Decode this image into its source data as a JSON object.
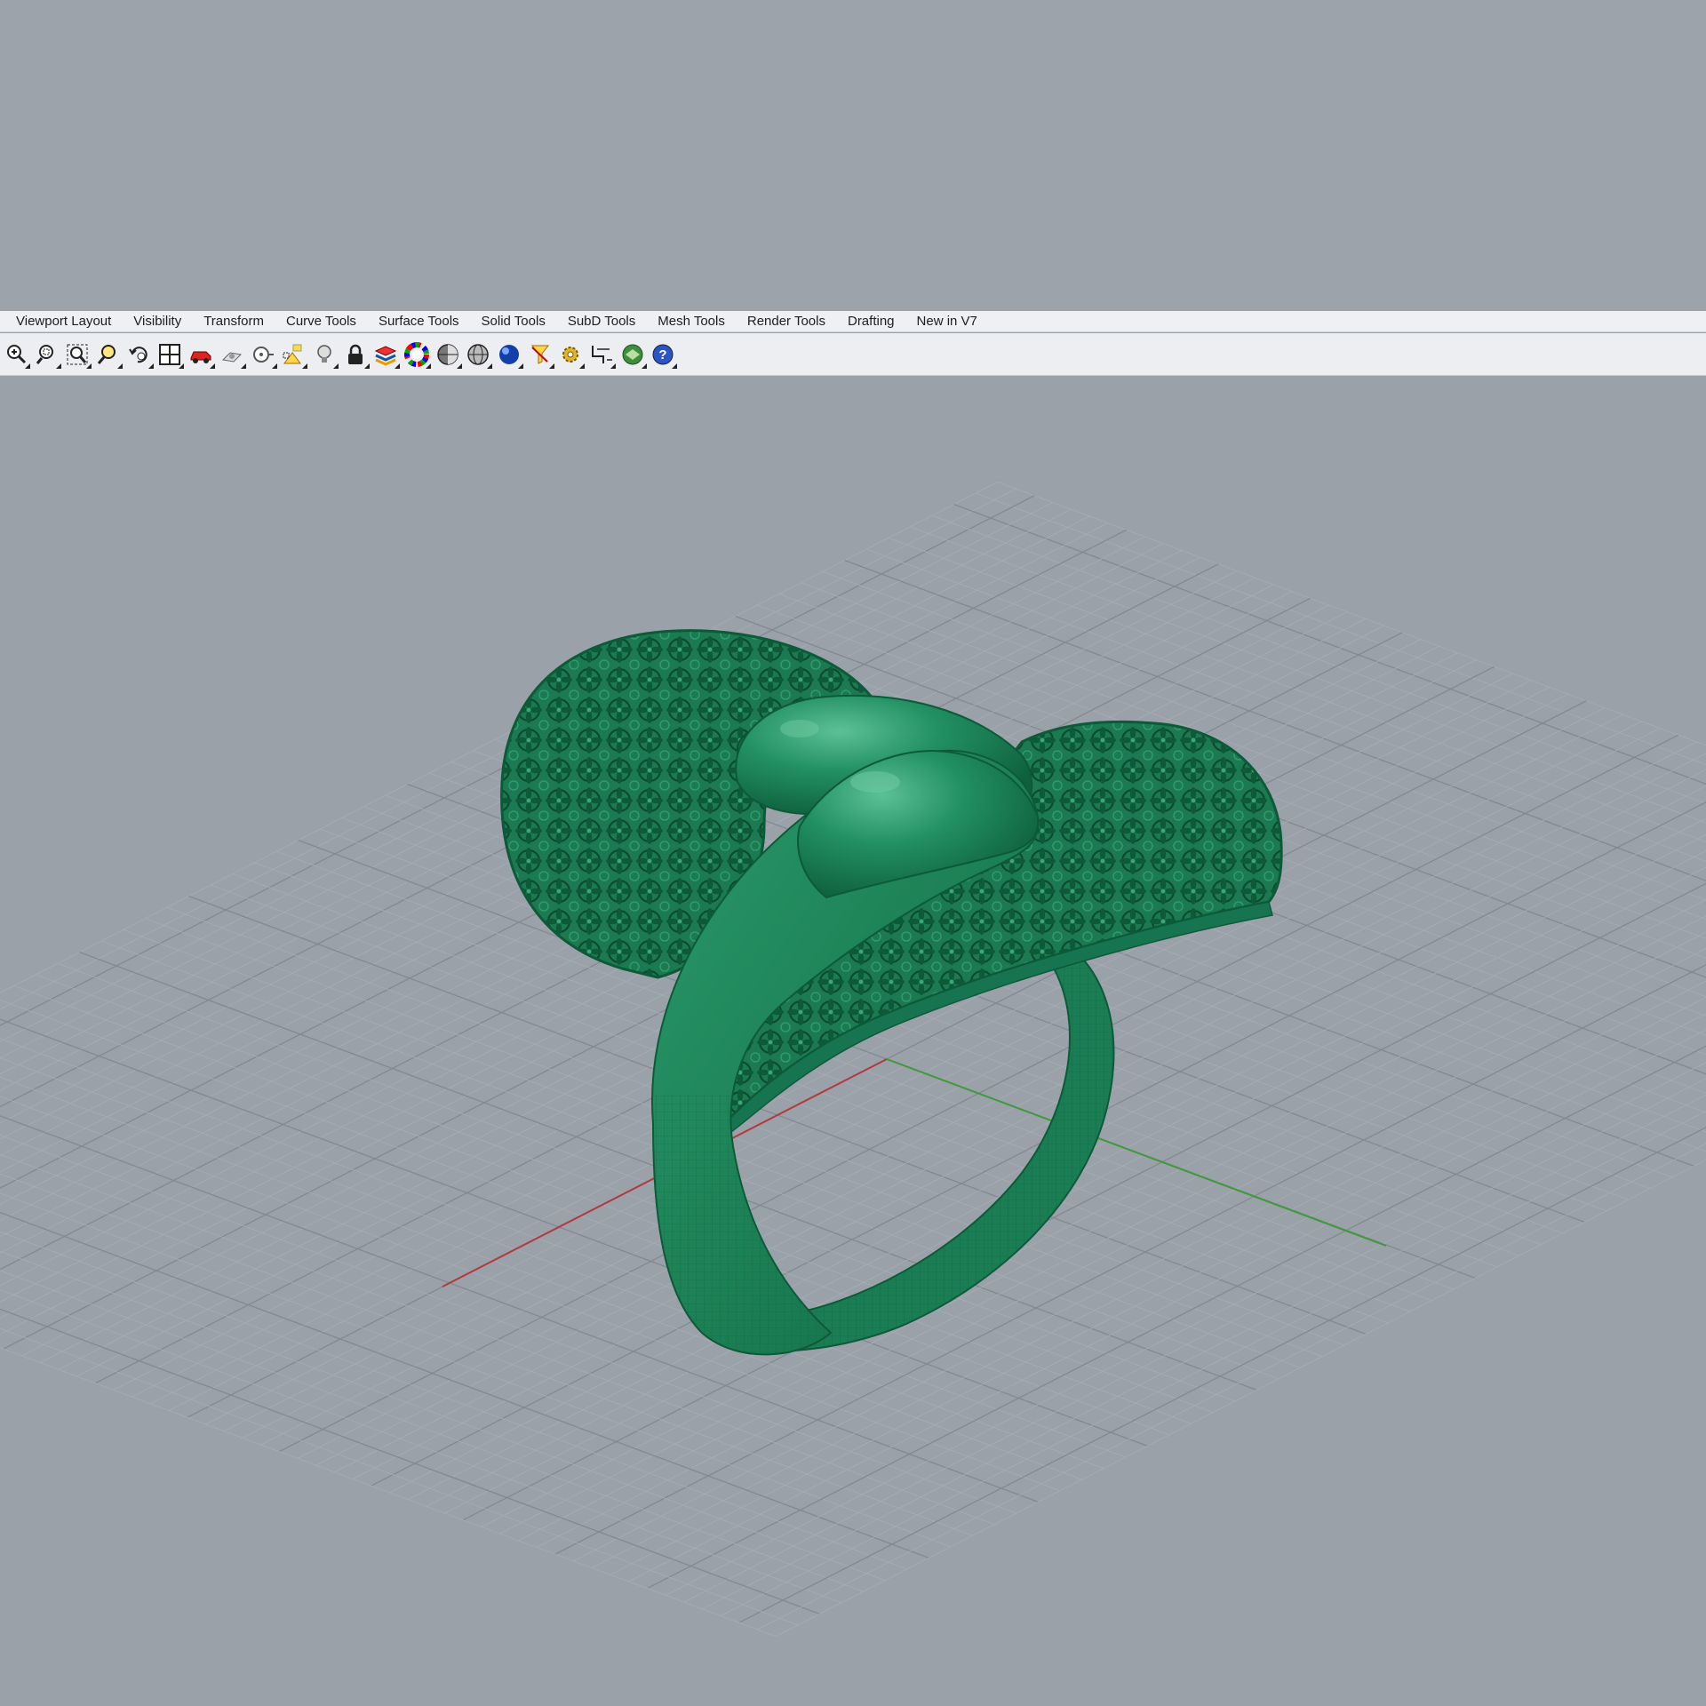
{
  "tabs": [
    {
      "label": "Viewport Layout"
    },
    {
      "label": "Visibility"
    },
    {
      "label": "Transform"
    },
    {
      "label": "Curve Tools"
    },
    {
      "label": "Surface Tools"
    },
    {
      "label": "Solid Tools"
    },
    {
      "label": "SubD Tools"
    },
    {
      "label": "Mesh Tools"
    },
    {
      "label": "Render Tools"
    },
    {
      "label": "Drafting"
    },
    {
      "label": "New in V7"
    }
  ],
  "toolbar_icons": [
    "zoom-in-icon",
    "zoom-window-icon",
    "zoom-extents-icon",
    "zoom-selected-icon",
    "undo-view-icon",
    "four-viewports-icon",
    "car-icon",
    "named-view-icon",
    "set-cplane-icon",
    "object-snap-icon",
    "light-bulb-icon",
    "lock-icon",
    "layer-material-icon",
    "color-wheel-icon",
    "shaded-sphere-icon",
    "rendered-sphere-icon",
    "render-sphere-icon",
    "select-filter-icon",
    "options-gear-icon",
    "dimension-icon",
    "globe-icon",
    "help-icon"
  ],
  "colors": {
    "viewport_background": "#9aa1a9",
    "model_green": "#1f8a5e",
    "x_axis": "#b23a3a",
    "y_axis": "#3f9a3a",
    "grid": "#8c9299"
  }
}
